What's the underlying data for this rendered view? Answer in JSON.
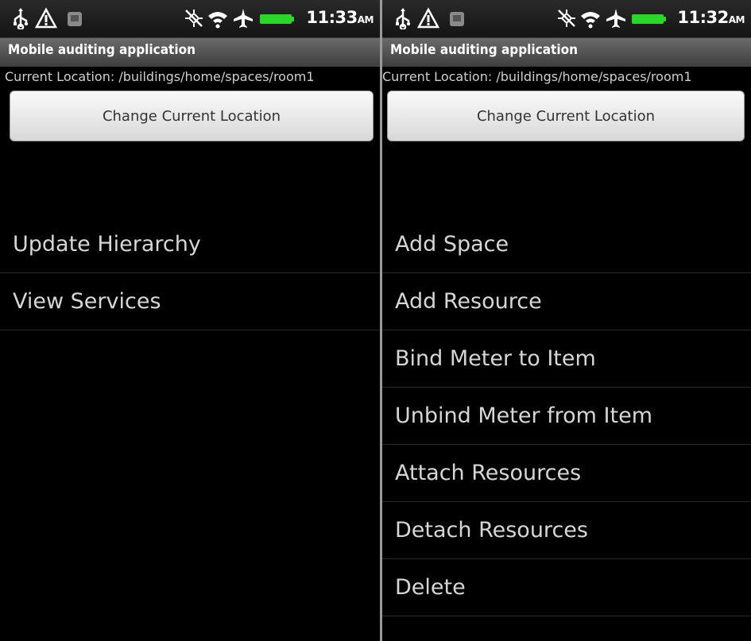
{
  "left": {
    "status": {
      "time": "11:33",
      "ampm": "AM"
    },
    "app_title": "Mobile auditing application",
    "location_label": "Current Location: /buildings/home/spaces/room1",
    "change_location_button": "Change Current Location",
    "menu": [
      "Update Hierarchy",
      "View Services"
    ]
  },
  "right": {
    "status": {
      "time": "11:32",
      "ampm": "AM"
    },
    "app_title": "Mobile auditing application",
    "location_label": "Current Location: /buildings/home/spaces/room1",
    "change_location_button": "Change Current Location",
    "menu": [
      "Add Space",
      "Add Resource",
      "Bind Meter to Item",
      "Unbind Meter from Item",
      "Attach Resources",
      "Detach Resources",
      "Delete"
    ]
  },
  "icons": [
    "usb-icon",
    "warning-icon",
    "sd-card-icon",
    "gps-off-icon",
    "wifi-icon",
    "airplane-icon",
    "battery-icon"
  ],
  "colors": {
    "battery": "#2bd62b",
    "status_bg": "#1c1c1c",
    "title_bg": "#5a5a5a",
    "button_bg": "#e6e6e6"
  }
}
